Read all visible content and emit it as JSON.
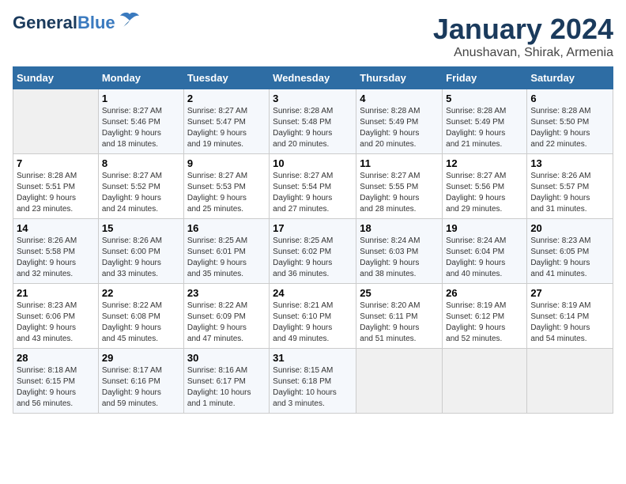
{
  "header": {
    "logo_general": "General",
    "logo_blue": "Blue",
    "title": "January 2024",
    "subtitle": "Anushavan, Shirak, Armenia"
  },
  "calendar": {
    "days_of_week": [
      "Sunday",
      "Monday",
      "Tuesday",
      "Wednesday",
      "Thursday",
      "Friday",
      "Saturday"
    ],
    "weeks": [
      [
        {
          "day": "",
          "info": ""
        },
        {
          "day": "1",
          "info": "Sunrise: 8:27 AM\nSunset: 5:46 PM\nDaylight: 9 hours\nand 18 minutes."
        },
        {
          "day": "2",
          "info": "Sunrise: 8:27 AM\nSunset: 5:47 PM\nDaylight: 9 hours\nand 19 minutes."
        },
        {
          "day": "3",
          "info": "Sunrise: 8:28 AM\nSunset: 5:48 PM\nDaylight: 9 hours\nand 20 minutes."
        },
        {
          "day": "4",
          "info": "Sunrise: 8:28 AM\nSunset: 5:49 PM\nDaylight: 9 hours\nand 20 minutes."
        },
        {
          "day": "5",
          "info": "Sunrise: 8:28 AM\nSunset: 5:49 PM\nDaylight: 9 hours\nand 21 minutes."
        },
        {
          "day": "6",
          "info": "Sunrise: 8:28 AM\nSunset: 5:50 PM\nDaylight: 9 hours\nand 22 minutes."
        }
      ],
      [
        {
          "day": "7",
          "info": "Sunrise: 8:28 AM\nSunset: 5:51 PM\nDaylight: 9 hours\nand 23 minutes."
        },
        {
          "day": "8",
          "info": "Sunrise: 8:27 AM\nSunset: 5:52 PM\nDaylight: 9 hours\nand 24 minutes."
        },
        {
          "day": "9",
          "info": "Sunrise: 8:27 AM\nSunset: 5:53 PM\nDaylight: 9 hours\nand 25 minutes."
        },
        {
          "day": "10",
          "info": "Sunrise: 8:27 AM\nSunset: 5:54 PM\nDaylight: 9 hours\nand 27 minutes."
        },
        {
          "day": "11",
          "info": "Sunrise: 8:27 AM\nSunset: 5:55 PM\nDaylight: 9 hours\nand 28 minutes."
        },
        {
          "day": "12",
          "info": "Sunrise: 8:27 AM\nSunset: 5:56 PM\nDaylight: 9 hours\nand 29 minutes."
        },
        {
          "day": "13",
          "info": "Sunrise: 8:26 AM\nSunset: 5:57 PM\nDaylight: 9 hours\nand 31 minutes."
        }
      ],
      [
        {
          "day": "14",
          "info": "Sunrise: 8:26 AM\nSunset: 5:58 PM\nDaylight: 9 hours\nand 32 minutes."
        },
        {
          "day": "15",
          "info": "Sunrise: 8:26 AM\nSunset: 6:00 PM\nDaylight: 9 hours\nand 33 minutes."
        },
        {
          "day": "16",
          "info": "Sunrise: 8:25 AM\nSunset: 6:01 PM\nDaylight: 9 hours\nand 35 minutes."
        },
        {
          "day": "17",
          "info": "Sunrise: 8:25 AM\nSunset: 6:02 PM\nDaylight: 9 hours\nand 36 minutes."
        },
        {
          "day": "18",
          "info": "Sunrise: 8:24 AM\nSunset: 6:03 PM\nDaylight: 9 hours\nand 38 minutes."
        },
        {
          "day": "19",
          "info": "Sunrise: 8:24 AM\nSunset: 6:04 PM\nDaylight: 9 hours\nand 40 minutes."
        },
        {
          "day": "20",
          "info": "Sunrise: 8:23 AM\nSunset: 6:05 PM\nDaylight: 9 hours\nand 41 minutes."
        }
      ],
      [
        {
          "day": "21",
          "info": "Sunrise: 8:23 AM\nSunset: 6:06 PM\nDaylight: 9 hours\nand 43 minutes."
        },
        {
          "day": "22",
          "info": "Sunrise: 8:22 AM\nSunset: 6:08 PM\nDaylight: 9 hours\nand 45 minutes."
        },
        {
          "day": "23",
          "info": "Sunrise: 8:22 AM\nSunset: 6:09 PM\nDaylight: 9 hours\nand 47 minutes."
        },
        {
          "day": "24",
          "info": "Sunrise: 8:21 AM\nSunset: 6:10 PM\nDaylight: 9 hours\nand 49 minutes."
        },
        {
          "day": "25",
          "info": "Sunrise: 8:20 AM\nSunset: 6:11 PM\nDaylight: 9 hours\nand 51 minutes."
        },
        {
          "day": "26",
          "info": "Sunrise: 8:19 AM\nSunset: 6:12 PM\nDaylight: 9 hours\nand 52 minutes."
        },
        {
          "day": "27",
          "info": "Sunrise: 8:19 AM\nSunset: 6:14 PM\nDaylight: 9 hours\nand 54 minutes."
        }
      ],
      [
        {
          "day": "28",
          "info": "Sunrise: 8:18 AM\nSunset: 6:15 PM\nDaylight: 9 hours\nand 56 minutes."
        },
        {
          "day": "29",
          "info": "Sunrise: 8:17 AM\nSunset: 6:16 PM\nDaylight: 9 hours\nand 59 minutes."
        },
        {
          "day": "30",
          "info": "Sunrise: 8:16 AM\nSunset: 6:17 PM\nDaylight: 10 hours\nand 1 minute."
        },
        {
          "day": "31",
          "info": "Sunrise: 8:15 AM\nSunset: 6:18 PM\nDaylight: 10 hours\nand 3 minutes."
        },
        {
          "day": "",
          "info": ""
        },
        {
          "day": "",
          "info": ""
        },
        {
          "day": "",
          "info": ""
        }
      ]
    ]
  }
}
